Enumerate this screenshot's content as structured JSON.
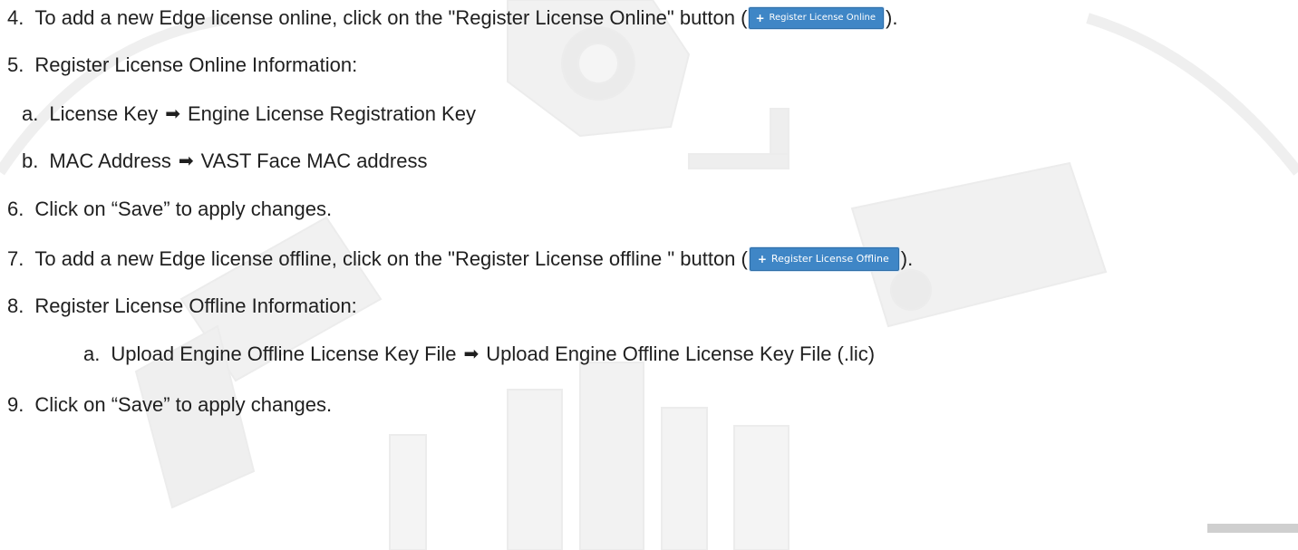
{
  "steps": [
    {
      "num": "4.",
      "before": "To add a new Edge license online, click on the \"Register License Online\" button (",
      "button": "Register License Online",
      "after": ")."
    },
    {
      "num": "5.",
      "text": "Register License Online Information:"
    },
    {
      "num": "a.",
      "left": "License Key",
      "right": "Engine License Registration Key"
    },
    {
      "num": "b.",
      "left": "MAC Address",
      "right": " VAST Face MAC address"
    },
    {
      "num": "6.",
      "text": "Click on “Save” to apply changes."
    },
    {
      "num": "7.",
      "before": "To add a new Edge license offline, click on the \"Register License offline \" button (",
      "button": "Register License Offline",
      "after": ")."
    },
    {
      "num": "8.",
      "text": "Register License Offline Information:"
    },
    {
      "num": "a.",
      "left": "Upload Engine Offline License Key File ",
      "right": "Upload Engine Offline License Key File (.lic)"
    },
    {
      "num": "9.",
      "text": "Click on “Save” to apply changes."
    }
  ],
  "icons": {
    "arrow": "arrow-right-icon",
    "plus": "plus-icon"
  },
  "colors": {
    "button_bg": "#3f86c6",
    "text": "#1f1f1f"
  }
}
